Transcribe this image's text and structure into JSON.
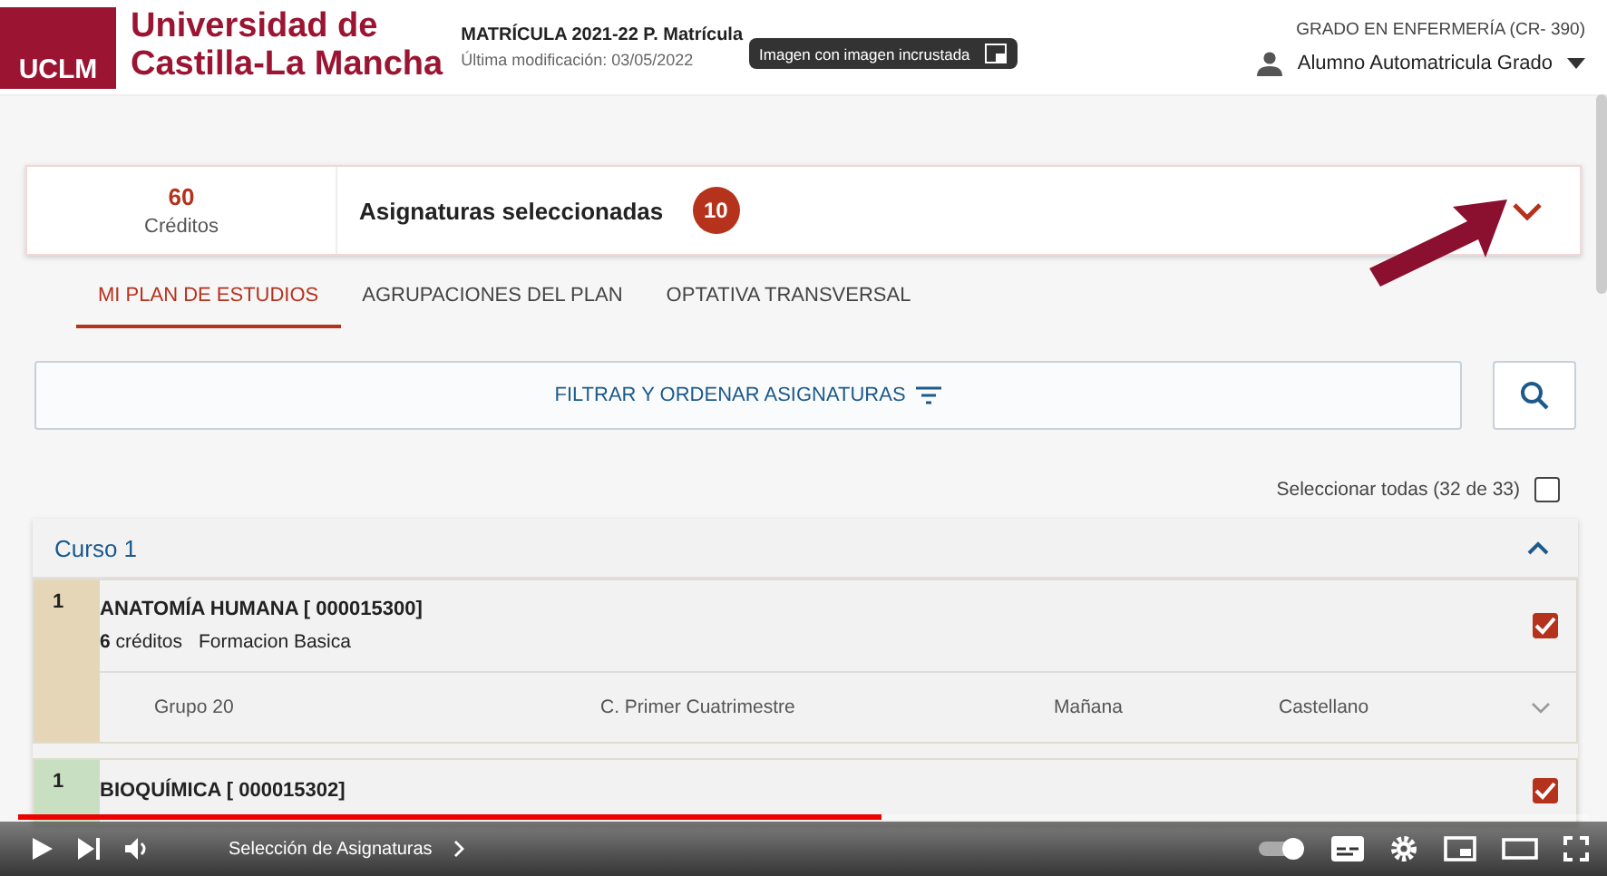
{
  "header": {
    "logo_mark": "UCLM",
    "university": [
      "Universidad de",
      "Castilla-La Mancha"
    ],
    "title": "MATRÍCULA 2021-22 P. Matrícula",
    "subtitle": "Última modificación: 03/05/2022",
    "degree": "GRADO EN ENFERMERÍA (CR- 390)",
    "user": "Alumno Automatricula Grado"
  },
  "tooltip": "Imagen con imagen incrustada",
  "summary": {
    "credits": "60",
    "credits_label": "Créditos",
    "title": "Asignaturas seleccionadas",
    "count": "10",
    "expanded": false
  },
  "tabs": [
    {
      "label": "MI PLAN DE ESTUDIOS",
      "selected": true
    },
    {
      "label": "AGRUPACIONES DEL PLAN",
      "selected": false
    },
    {
      "label": "OPTATIVA TRANSVERSAL",
      "selected": false
    }
  ],
  "filter": {
    "label": "FILTRAR Y ORDENAR ASIGNATURAS"
  },
  "select_all": {
    "label": "Seleccionar todas (32 de 33)",
    "checked": false
  },
  "course": {
    "title": "Curso 1",
    "expanded": true,
    "subjects": [
      {
        "number": "1",
        "title": "ANATOMÍA HUMANA [ 000015300]",
        "credits": "6",
        "credits_unit": "créditos",
        "type": "Formacion Basica",
        "checked": true,
        "color": "#e6d6b8",
        "group": {
          "name": "Grupo 20",
          "period": "C. Primer Cuatrimestre",
          "shift": "Mañana",
          "language": "Castellano"
        }
      },
      {
        "number": "1",
        "title": "BIOQUÍMICA [ 000015302]",
        "checked": true,
        "color": "#c9dfc1"
      }
    ]
  },
  "player": {
    "chapter": "Selección de Asignaturas",
    "level": 0.55
  }
}
